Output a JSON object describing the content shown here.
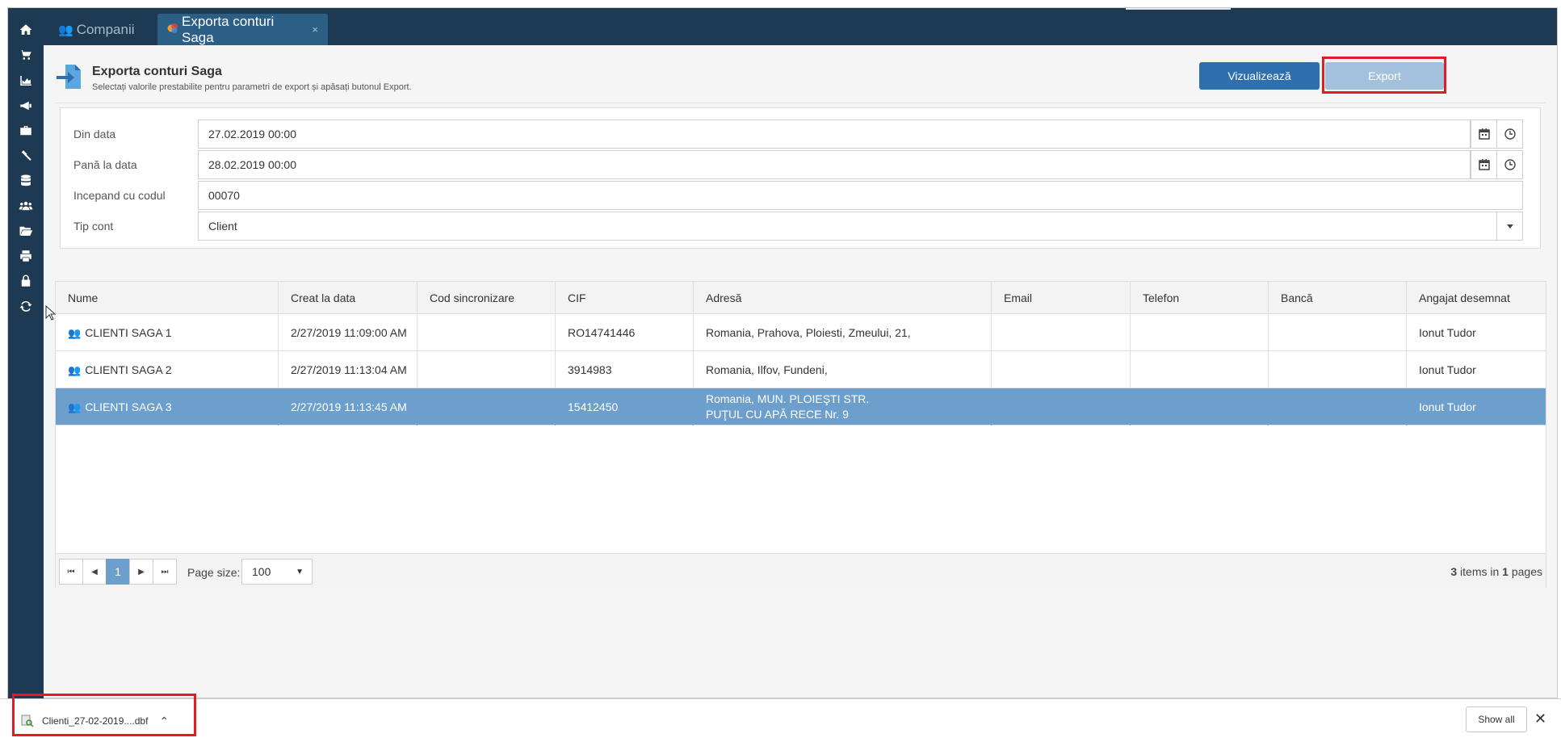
{
  "tabs": [
    {
      "label": "Companii",
      "icon": "users-icon",
      "active": false
    },
    {
      "label": "Exporta conturi Saga",
      "icon": "saga-logo-icon",
      "active": true,
      "close": "×"
    }
  ],
  "sidebar": {
    "icons": [
      "home-icon",
      "cart-icon",
      "chart-icon",
      "megaphone-icon",
      "briefcase-icon",
      "gavel-icon",
      "database-icon",
      "users-icon",
      "folder-icon",
      "print-icon",
      "lock-icon",
      "refresh-icon"
    ]
  },
  "header": {
    "title": "Exporta conturi Saga",
    "subtitle": "Selectați valorile prestabilite pentru parametri de export și apăsați butonul Export.",
    "view_button": "Vizualizează",
    "export_button": "Export"
  },
  "form": {
    "from_label": "Din data",
    "from_value": "27.02.2019 00:00",
    "to_label": "Pană la data",
    "to_value": "28.02.2019 00:00",
    "code_label": "Incepand cu codul",
    "code_value": "00070",
    "type_label": "Tip cont",
    "type_value": "Client"
  },
  "grid": {
    "columns": [
      "Nume",
      "Creat la data",
      "Cod sincronizare",
      "CIF",
      "Adresă",
      "Email",
      "Telefon",
      "Bancă",
      "Angajat desemnat"
    ],
    "rows": [
      {
        "name": "CLIENTI SAGA 1",
        "created": "2/27/2019 11:09:00 AM",
        "sync": "",
        "cif": "RO14741446",
        "address": "Romania, Prahova, Ploiesti, Zmeului, 21,",
        "email": "",
        "phone": "",
        "bank": "",
        "employee": "Ionut Tudor",
        "selected": false
      },
      {
        "name": "CLIENTI SAGA 2",
        "created": "2/27/2019 11:13:04 AM",
        "sync": "",
        "cif": "3914983",
        "address": "Romania, Ilfov, Fundeni,",
        "email": "",
        "phone": "",
        "bank": "",
        "employee": "Ionut Tudor",
        "selected": false
      },
      {
        "name": "CLIENTI SAGA 3",
        "created": "2/27/2019 11:13:45 AM",
        "sync": "",
        "cif": "15412450",
        "address": "Romania, MUN. PLOIEŞTI STR. PUŢUL CU APĂ RECE Nr. 9",
        "email": "",
        "phone": "",
        "bank": "",
        "employee": "Ionut Tudor",
        "selected": true
      }
    ]
  },
  "pager": {
    "current_page": "1",
    "page_size_label": "Page size:",
    "page_size": "100",
    "items_count": "3",
    "items_text": " items in ",
    "pages_count": "1",
    "pages_text": " pages"
  },
  "download_bar": {
    "file_name": "Clienti_27-02-2019....dbf",
    "show_all": "Show all",
    "close": "✕"
  },
  "colors": {
    "nav_bg": "#1e3a52",
    "active_tab": "#2c5f86",
    "primary": "#2f6fad",
    "selected_row": "#6d9fcd",
    "highlight": "#e21b25"
  }
}
